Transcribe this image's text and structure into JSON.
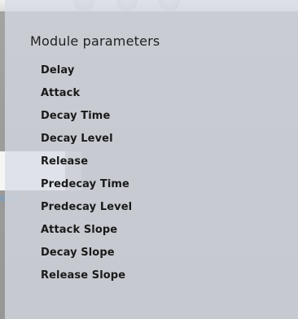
{
  "menu": {
    "title": "Module parameters",
    "items": [
      {
        "label": "Delay"
      },
      {
        "label": "Attack"
      },
      {
        "label": "Decay Time"
      },
      {
        "label": "Decay Level"
      },
      {
        "label": "Release"
      },
      {
        "label": "Predecay Time"
      },
      {
        "label": "Predecay Level"
      },
      {
        "label": "Attack Slope"
      },
      {
        "label": "Decay Slope"
      },
      {
        "label": "Release Slope"
      }
    ]
  },
  "background": {
    "out_label": "OUT"
  },
  "colors": {
    "menu_bg": "#d6dce4",
    "text": "#1a1a1a",
    "out_label": "#6f9ec9"
  }
}
